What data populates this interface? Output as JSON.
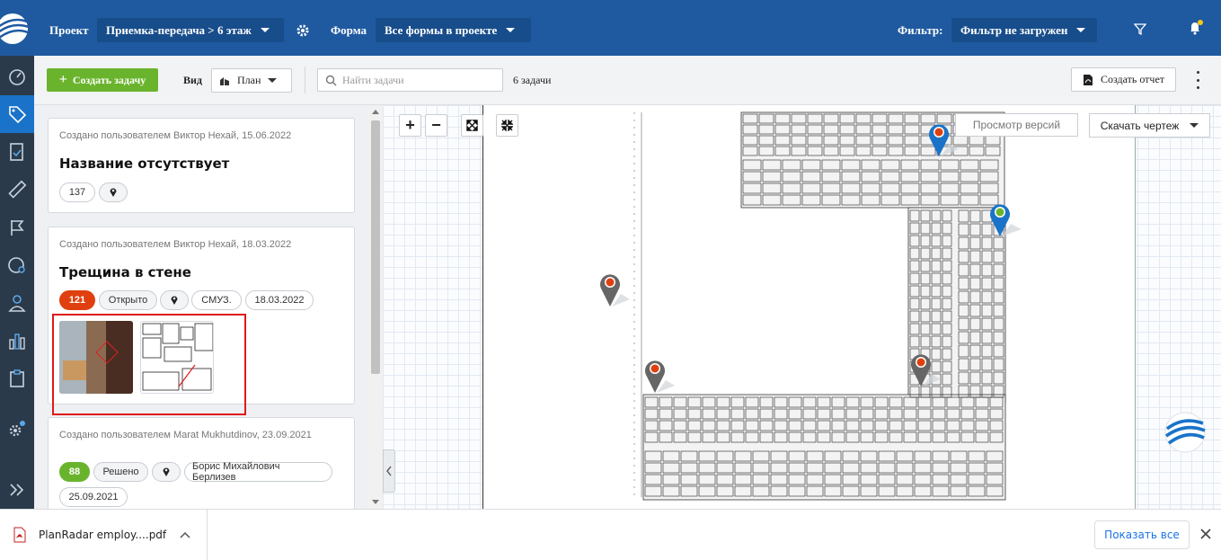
{
  "header": {
    "project_label": "Проект",
    "project_value": "Приемка-передача > 6 этаж",
    "form_label": "Форма",
    "form_value": "Все формы в проекте",
    "filter_label": "Фильтр:",
    "filter_value": "Фильтр не загружен",
    "brand_color": "#1f5aa0",
    "notification_dot_color": "#f5c518"
  },
  "sidebar": {
    "items": [
      {
        "icon": "dashboard-icon"
      },
      {
        "icon": "tag-icon",
        "active": true
      },
      {
        "icon": "document-check-icon"
      },
      {
        "icon": "ruler-icon"
      },
      {
        "icon": "flag-icon"
      },
      {
        "icon": "gauge-icon"
      },
      {
        "icon": "user-icon"
      },
      {
        "icon": "bar-chart-icon"
      },
      {
        "icon": "clipboard-icon"
      },
      {
        "icon": "settings-icon"
      },
      {
        "icon": "expand-icon"
      }
    ]
  },
  "toolbar": {
    "create_label": "Создать задачу",
    "view_label": "Вид",
    "view_value": "План",
    "search_placeholder": "Найти задачи",
    "task_count": "6 задачи",
    "report_label": "Создать отчет",
    "create_color": "#6ab42d"
  },
  "tasks": [
    {
      "meta": "Создано пользователем Виктор Нехай, 15.06.2022",
      "title": "Название отсутствует",
      "number": "137"
    },
    {
      "meta": "Создано пользователем Виктор Нехай, 18.03.2022",
      "title": "Трещина в стене",
      "number": "121",
      "status": "Открыто",
      "assignee": "СМУЗ.",
      "date": "18.03.2022",
      "status_color": "#e0400f"
    },
    {
      "meta": "Создано пользователем Marat Mukhutdinov, 23.09.2021",
      "title": "",
      "number": "88",
      "status": "Решено",
      "assignee": "Борис Михайлович Берлизев",
      "date": "25.09.2021",
      "status_color": "#6ab42d"
    }
  ],
  "map": {
    "versions_label": "Просмотр версий",
    "download_label": "Скачать чертеж"
  },
  "downloads": {
    "file_name": "PlanRadar employ....pdf",
    "show_all_label": "Показать все"
  }
}
